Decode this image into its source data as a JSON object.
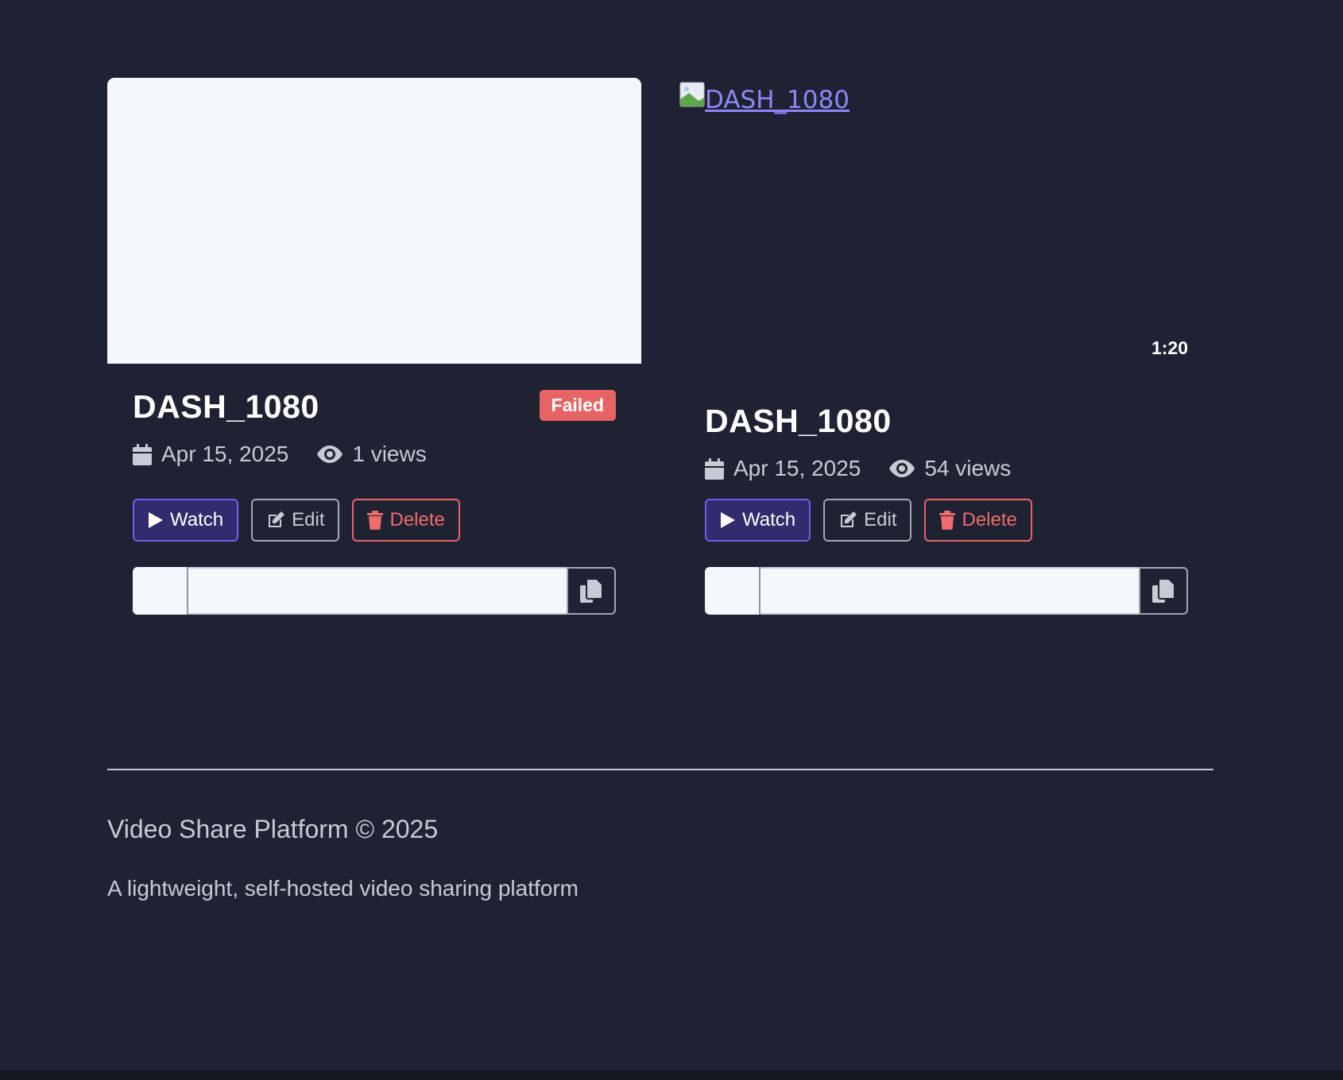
{
  "videos": [
    {
      "title": "DASH_1080",
      "thumbnail_state": "blank",
      "status_badge": "Failed",
      "date": "Apr 15, 2025",
      "views": "1 views",
      "actions": {
        "watch": "Watch",
        "edit": "Edit",
        "delete": "Delete"
      },
      "share_value": ""
    },
    {
      "title": "DASH_1080",
      "thumbnail_state": "broken",
      "thumbnail_alt": "DASH_1080",
      "duration": "1:20",
      "date": "Apr 15, 2025",
      "views": "54 views",
      "actions": {
        "watch": "Watch",
        "edit": "Edit",
        "delete": "Delete"
      },
      "share_value": ""
    }
  ],
  "footer": {
    "copyright": "Video Share Platform © 2025",
    "tagline": "A lightweight, self-hosted video sharing platform"
  },
  "colors": {
    "background": "#1e2233",
    "accent": "#6b63e8",
    "danger": "#e86464",
    "link": "#8d86f5"
  },
  "icons": {
    "calendar": "calendar-icon",
    "views": "eye-icon",
    "watch": "play-icon",
    "edit": "edit-icon",
    "delete": "trash-icon",
    "copy": "copy-icon",
    "broken_image": "broken-image-icon"
  }
}
